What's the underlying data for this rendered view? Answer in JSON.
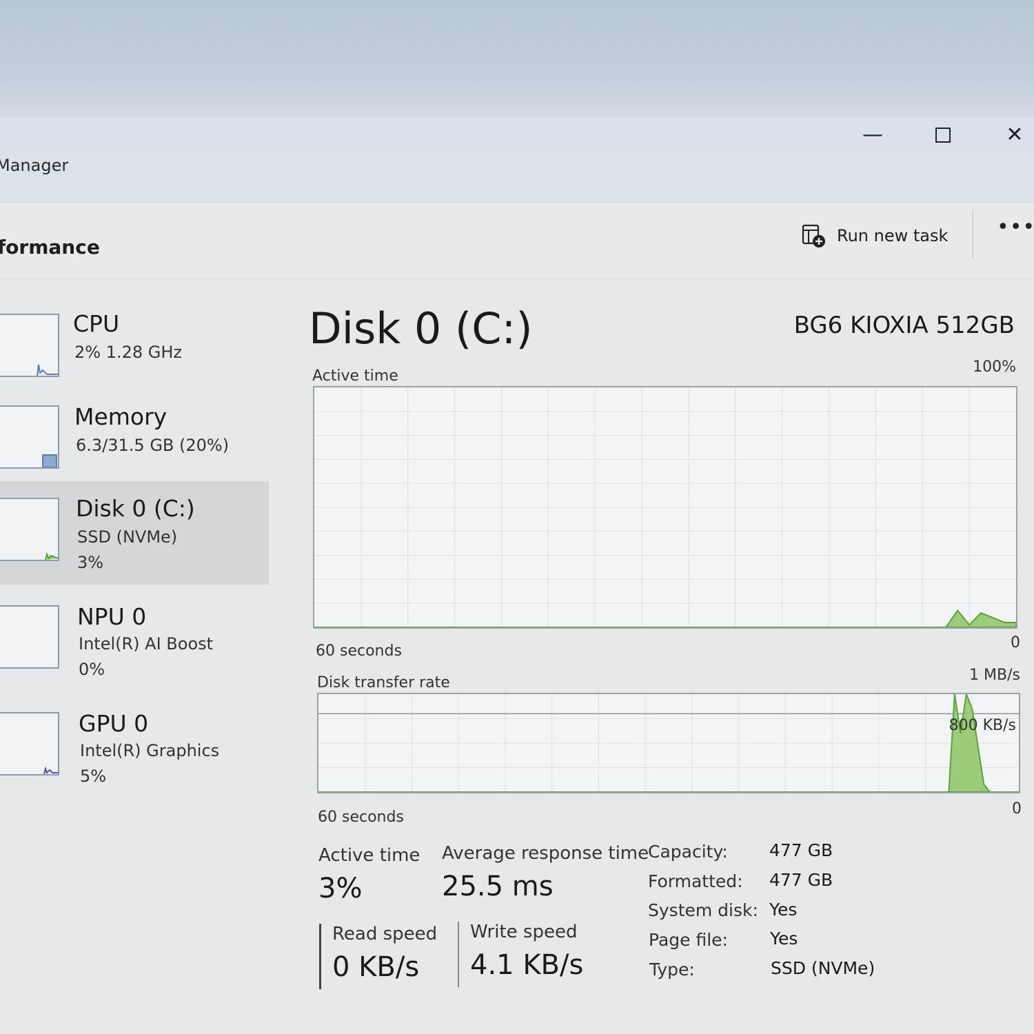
{
  "window": {
    "title": "Manager",
    "minimize_glyph": "—",
    "close_glyph": "✕"
  },
  "header": {
    "page_title": "formance",
    "run_new_task": "Run new task",
    "more_glyph": "•••"
  },
  "sidebar": {
    "items": [
      {
        "name": "CPU",
        "line1": "2%  1.28 GHz",
        "line2": "",
        "thumb_level": 0.02,
        "selected": false
      },
      {
        "name": "Memory",
        "line1": "6.3/31.5 GB (20%)",
        "line2": "",
        "thumb_level": 0.2,
        "selected": false
      },
      {
        "name": "Disk 0 (C:)",
        "line1": "SSD (NVMe)",
        "line2": "3%",
        "thumb_level": 0.03,
        "selected": true
      },
      {
        "name": "NPU 0",
        "line1": "Intel(R) AI Boost",
        "line2": "0%",
        "thumb_level": 0.0,
        "selected": false
      },
      {
        "name": "GPU 0",
        "line1": "Intel(R) Graphics",
        "line2": "5%",
        "thumb_level": 0.05,
        "selected": false
      }
    ]
  },
  "detail": {
    "title": "Disk 0 (C:)",
    "model": "BG6 KIOXIA 512GB",
    "active_graph": {
      "label": "Active time",
      "max_label": "100%",
      "time_label": "60 seconds",
      "min_label": "0"
    },
    "transfer_graph": {
      "label": "Disk transfer rate",
      "max_label": "1 MB/s",
      "mid_label": "800 KB/s",
      "time_label": "60 seconds",
      "min_label": "0"
    },
    "stats": {
      "active_time_label": "Active time",
      "active_time_value": "3%",
      "avg_response_label": "Average response time",
      "avg_response_value": "25.5 ms",
      "read_speed_label": "Read speed",
      "read_speed_value": "0 KB/s",
      "write_speed_label": "Write speed",
      "write_speed_value": "4.1 KB/s"
    },
    "properties": [
      {
        "key": "Capacity:",
        "value": "477 GB"
      },
      {
        "key": "Formatted:",
        "value": "477 GB"
      },
      {
        "key": "System disk:",
        "value": "Yes"
      },
      {
        "key": "Page file:",
        "value": "Yes"
      },
      {
        "key": "Type:",
        "value": "SSD (NVMe)"
      }
    ]
  },
  "chart_data": [
    {
      "type": "area",
      "title": "Active time",
      "ylabel": "",
      "ylim": [
        0,
        100
      ],
      "xlim": [
        60,
        0
      ],
      "x": [
        60,
        6,
        5,
        4,
        3,
        2,
        1,
        0
      ],
      "values": [
        0,
        0,
        7,
        1,
        6,
        4,
        2,
        2
      ],
      "colors": {
        "fill": "#9ccc7a",
        "stroke": "#5aa33a"
      }
    },
    {
      "type": "area",
      "title": "Disk transfer rate",
      "ylabel": "",
      "ylim": [
        0,
        1000
      ],
      "xlim": [
        60,
        0
      ],
      "x": [
        60,
        6,
        5.5,
        5,
        4.5,
        4,
        3,
        2.5,
        2,
        0
      ],
      "values": [
        0,
        0,
        1000,
        600,
        1000,
        850,
        80,
        0,
        0,
        0
      ],
      "colors": {
        "fill": "#9ccc7a",
        "stroke": "#5aa33a"
      }
    }
  ]
}
